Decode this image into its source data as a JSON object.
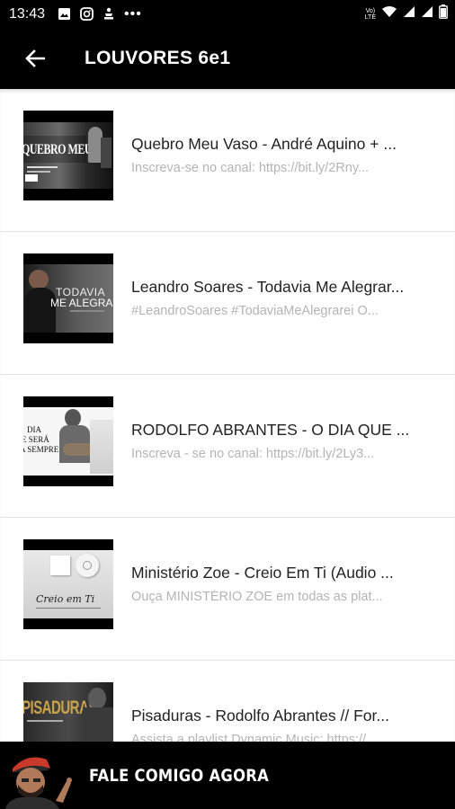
{
  "status_bar": {
    "time": "13:43",
    "network_label_top": "Vo)",
    "network_label_mid": "LTE",
    "battery_icon": "battery-icon",
    "wifi_icon": "wifi-icon"
  },
  "app_bar": {
    "title": "LOUVORES 6e1",
    "back_icon": "arrow-left-icon"
  },
  "videos": [
    {
      "title": "Quebro Meu Vaso - André Aquino + ...",
      "description": "Inscreva-se no canal: https://bit.ly/2Rny...",
      "thumb_text": "QUEBRO MEU VASO"
    },
    {
      "title": "Leandro Soares - Todavia Me Alegrar...",
      "description": "#LeandroSoares #TodaviaMeAlegrarei O...",
      "thumb_text_1": "TODAVIA",
      "thumb_text_2": "ME ALEGRAR"
    },
    {
      "title": "RODOLFO ABRANTES - O DIA QUE ...",
      "description": "Inscreva - se no canal: https://bit.ly/2Ly3...",
      "thumb_text_1": "DIA",
      "thumb_text_2": "E SERÁ",
      "thumb_text_3": "A SEMPRE"
    },
    {
      "title": "Ministério Zoe - Creio Em Ti (Audio ...",
      "description": "Ouça MINISTÉRIO ZOE em todas as plat...",
      "thumb_text": "Creio em Ti"
    },
    {
      "title": "Pisaduras - Rodolfo Abrantes // For...",
      "description": "Assista a playlist Dynamic Music: https://...",
      "thumb_text": "PISADURAS"
    }
  ],
  "banner": {
    "text": "FALE COMIGO AGORA"
  }
}
